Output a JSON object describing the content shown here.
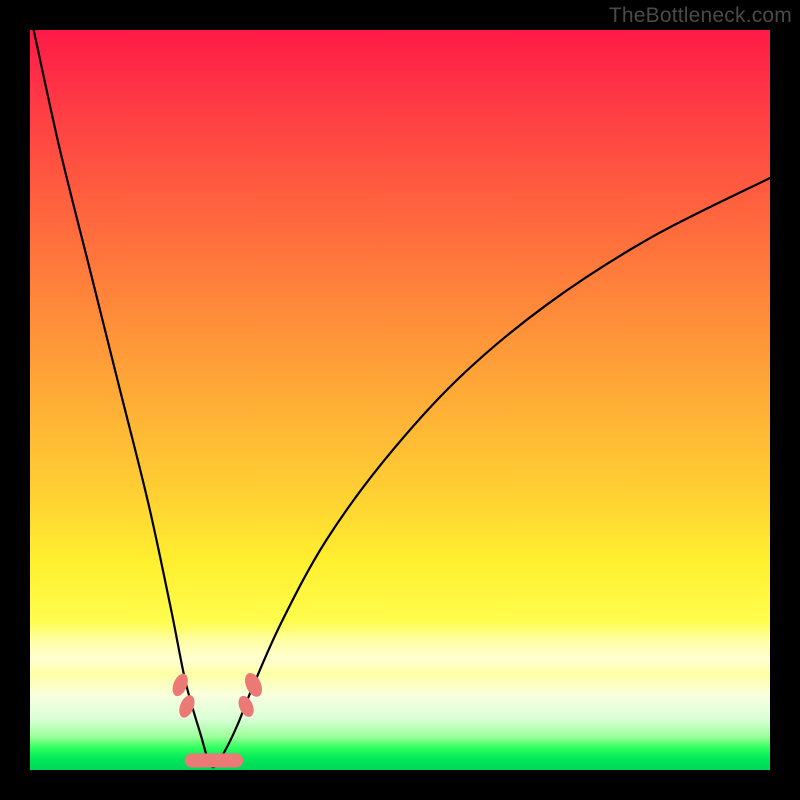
{
  "watermark_text": "TheBottleneck.com",
  "colors": {
    "frame": "#000000",
    "marker": "#eb7a77",
    "curve": "#000000",
    "gradient_top": "#ff1a47",
    "gradient_bottom": "#00d858"
  },
  "chart_data": {
    "type": "line",
    "title": "",
    "xlabel": "",
    "ylabel": "",
    "x_range_visible": [
      0,
      100
    ],
    "y_range_visible": [
      0,
      100
    ],
    "note": "Axes are unlabeled in the source image; values are estimated percentages of the plot area. The curve forms a sharp V with minimum near x≈25 reaching y≈0. Left branch rises steeply to y≈100 at x≈0; right branch rises with decreasing slope toward y≈80 at x=100.",
    "series": [
      {
        "name": "bottleneck-curve",
        "x": [
          0.5,
          4,
          8,
          12,
          16,
          19,
          21,
          23,
          24.5,
          26,
          28,
          30,
          34,
          40,
          48,
          58,
          70,
          84,
          100
        ],
        "y": [
          100,
          84,
          68,
          52,
          36,
          22,
          12,
          5,
          0.5,
          2,
          6,
          11,
          20,
          31,
          42,
          53,
          63,
          72,
          80
        ]
      }
    ],
    "markers": {
      "description": "Salmon-pink capsule/lozenge markers clustered around the curve minimum, estimated positions in plot-percent coordinates.",
      "points": [
        {
          "x": 20.3,
          "y": 11.5,
          "shape": "ellipse",
          "rx_pct": 0.9,
          "ry_pct": 1.6,
          "tilt_deg": 22
        },
        {
          "x": 21.2,
          "y": 8.6,
          "shape": "ellipse",
          "rx_pct": 0.9,
          "ry_pct": 1.6,
          "tilt_deg": 22
        },
        {
          "x": 30.2,
          "y": 11.5,
          "shape": "ellipse",
          "rx_pct": 1.0,
          "ry_pct": 1.7,
          "tilt_deg": -24
        },
        {
          "x": 29.2,
          "y": 8.6,
          "shape": "ellipse",
          "rx_pct": 0.9,
          "ry_pct": 1.5,
          "tilt_deg": -24
        },
        {
          "x": 22.8,
          "y": 1.3,
          "shape": "capsule",
          "w_pct": 3.8,
          "h_pct": 1.9
        },
        {
          "x": 26.8,
          "y": 1.3,
          "shape": "capsule",
          "w_pct": 4.0,
          "h_pct": 1.9
        },
        {
          "x": 25.0,
          "y": 1.3,
          "shape": "capsule",
          "w_pct": 3.2,
          "h_pct": 1.9
        }
      ]
    }
  }
}
